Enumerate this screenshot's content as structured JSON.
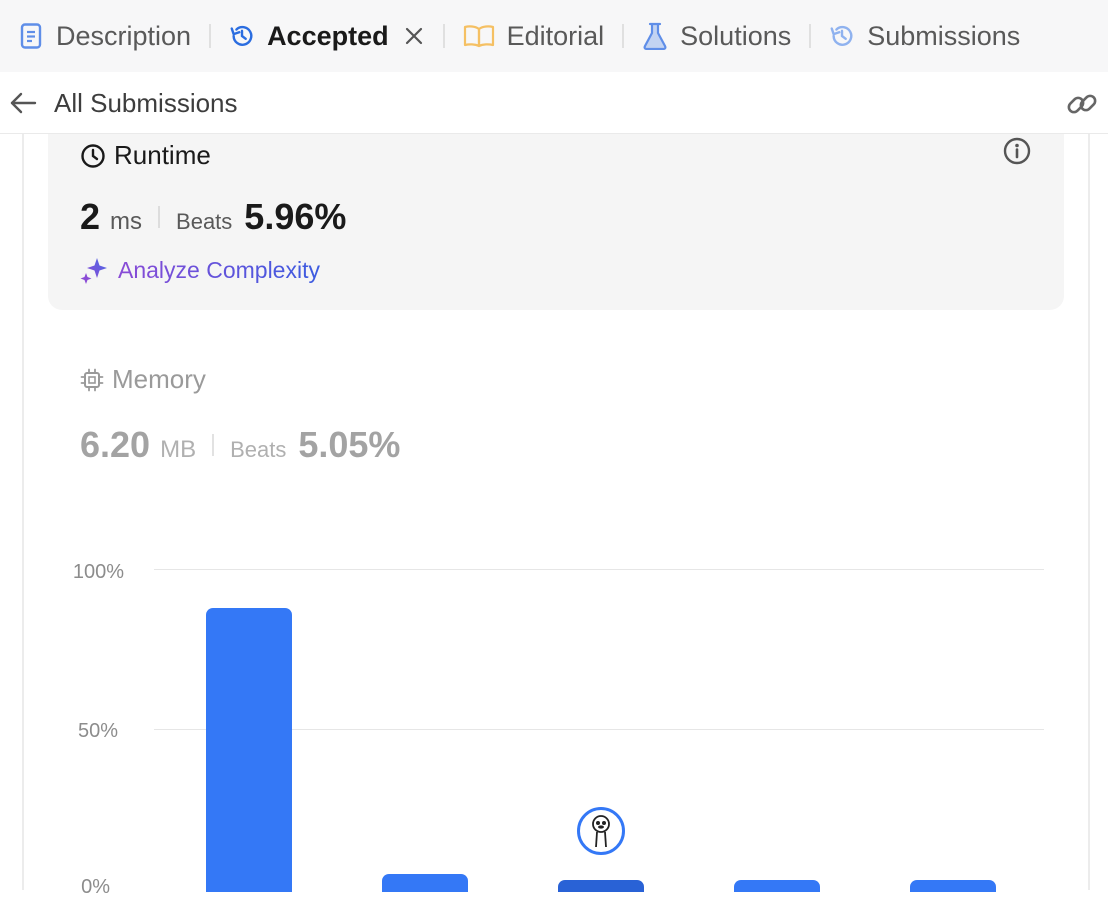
{
  "tabs": [
    {
      "label": "Description",
      "icon": "document-icon",
      "color": "#5f8ee8"
    },
    {
      "label": "Accepted",
      "icon": "history-icon",
      "color": "#2b6de0",
      "active": true
    },
    {
      "label": "Editorial",
      "icon": "book-icon",
      "color": "#f5c063"
    },
    {
      "label": "Solutions",
      "icon": "flask-icon",
      "color": "#5f8ee8"
    },
    {
      "label": "Submissions",
      "icon": "history-icon",
      "color": "#8fb2ef"
    }
  ],
  "subheader": {
    "title": "All Submissions"
  },
  "runtime": {
    "title": "Runtime",
    "value": "2",
    "unit": "ms",
    "beats_label": "Beats",
    "beats_pct": "5.96%",
    "analyze_label": "Analyze Complexity"
  },
  "memory": {
    "title": "Memory",
    "value": "6.20",
    "unit": "MB",
    "beats_label": "Beats",
    "beats_pct": "5.05%"
  },
  "colors": {
    "accent": "#3478f6",
    "accent_dark": "#2962d6",
    "analyze_gradient_start": "#8a4bd6",
    "analyze_gradient_end": "#3b5be0"
  },
  "chart_data": {
    "type": "bar",
    "ytick_labels": [
      "100%",
      "50%",
      "0%"
    ],
    "ylim": [
      0,
      100
    ],
    "values": [
      88,
      5,
      3,
      3,
      3
    ],
    "highlight_index": 2
  }
}
